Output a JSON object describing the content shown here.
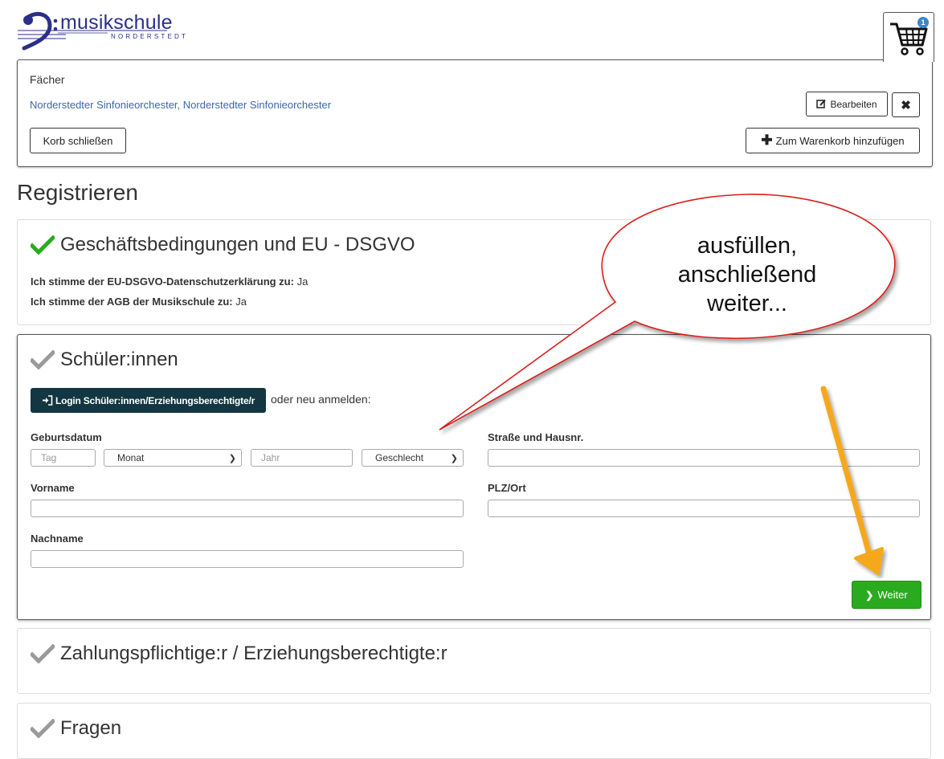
{
  "logo": {
    "brand": "musikschule",
    "sub": "NORDERSTEDT"
  },
  "cart": {
    "count": "1"
  },
  "basket": {
    "subjects_heading": "Fächer",
    "subjects_value": "Norderstedter Sinfonieorchester, Norderstedter Sinfonieorchester",
    "edit_label": "Bearbeiten",
    "remove_label": "✖",
    "close_label": "Korb schließen",
    "add_label": "Zum Warenkorb hinzufügen"
  },
  "register": {
    "title": "Registrieren",
    "terms": {
      "title": "Geschäftsbedingungen und EU - DSGVO",
      "privacy_label": "Ich stimme der EU-DSGVO-Datenschutzerklärung zu:",
      "privacy_value": "Ja",
      "agb_label": "Ich stimme der AGB der Musikschule zu:",
      "agb_value": "Ja"
    },
    "student": {
      "title": "Schüler:innen",
      "login_label": "Login Schüler:innen/Erziehungsberechtigte/r",
      "or_new": "oder neu anmelden:",
      "birthdate_label": "Geburtsdatum",
      "day_placeholder": "Tag",
      "month_value": "Monat",
      "year_placeholder": "Jahr",
      "gender_value": "Geschlecht",
      "firstname_label": "Vorname",
      "lastname_label": "Nachname",
      "street_label": "Straße und Hausnr.",
      "zip_label": "PLZ/Ort",
      "next_label": "Weiter"
    },
    "payer": {
      "title": "Zahlungspflichtige:r / Erziehungsberechtigte:r"
    },
    "questions": {
      "title": "Fragen"
    }
  },
  "annotation": {
    "line1": "ausfüllen,",
    "line2": "anschließend",
    "line3": "weiter..."
  },
  "colors": {
    "brand": "#2b2f8a",
    "link": "#3b68a8",
    "login_button": "#123642",
    "next_button": "#2aaa1f",
    "check_done": "#2aaa1f",
    "check_pending": "#9a9a9a",
    "arrow": "#f5a81c",
    "bubble_border": "#d9201e"
  }
}
